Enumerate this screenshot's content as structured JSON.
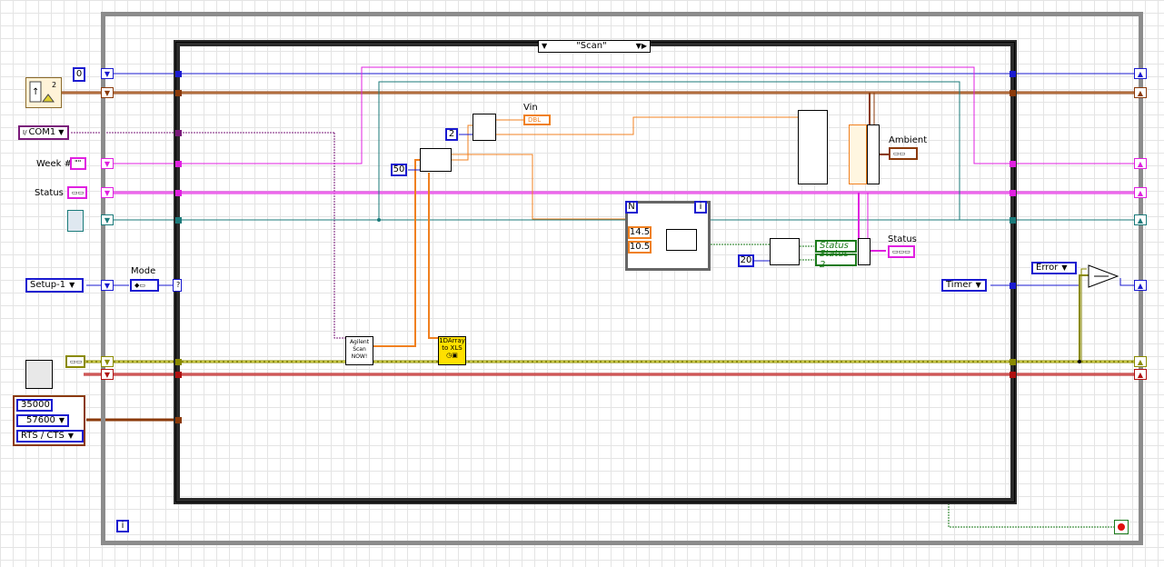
{
  "case_selector": {
    "value": "\"Scan\"",
    "arrows": "◀▶"
  },
  "constants": {
    "zero": "0",
    "two": "2",
    "fifty": "50",
    "twenty": "20",
    "v145": "14.5",
    "v105": "10.5",
    "baud_timeout": "35000",
    "baud_rate": "57600",
    "flow": "RTS / CTS"
  },
  "controls": {
    "com": "COM1",
    "week": "Week #",
    "week_value": "\"\"",
    "status": "Status",
    "setup": "Setup-1",
    "mode": "Mode",
    "timer": "Timer",
    "error": "Error"
  },
  "labels": {
    "vin": "Vin",
    "dbl": "DBL",
    "ambient": "Ambient",
    "status_label": "Status",
    "status1": "Status",
    "status2": "Status 2",
    "agilent1": "Agilent",
    "agilent2": "Scan",
    "agilent3": "NOW!",
    "xls1": "1DArray",
    "xls2": "to XLS",
    "for_n": "N",
    "info": "i",
    "loop_i": "i",
    "two_small": "2"
  },
  "colors": {
    "blue_wire": "#1a1ad0",
    "brown_wire": "#8b3a0a",
    "pink_wire": "#e020e0",
    "teal_wire": "#1a7a7a",
    "orange_wire": "#f08020",
    "green_wire": "#1a7a1a",
    "olive_wire": "#8a8a00",
    "red_wire": "#b01010"
  }
}
